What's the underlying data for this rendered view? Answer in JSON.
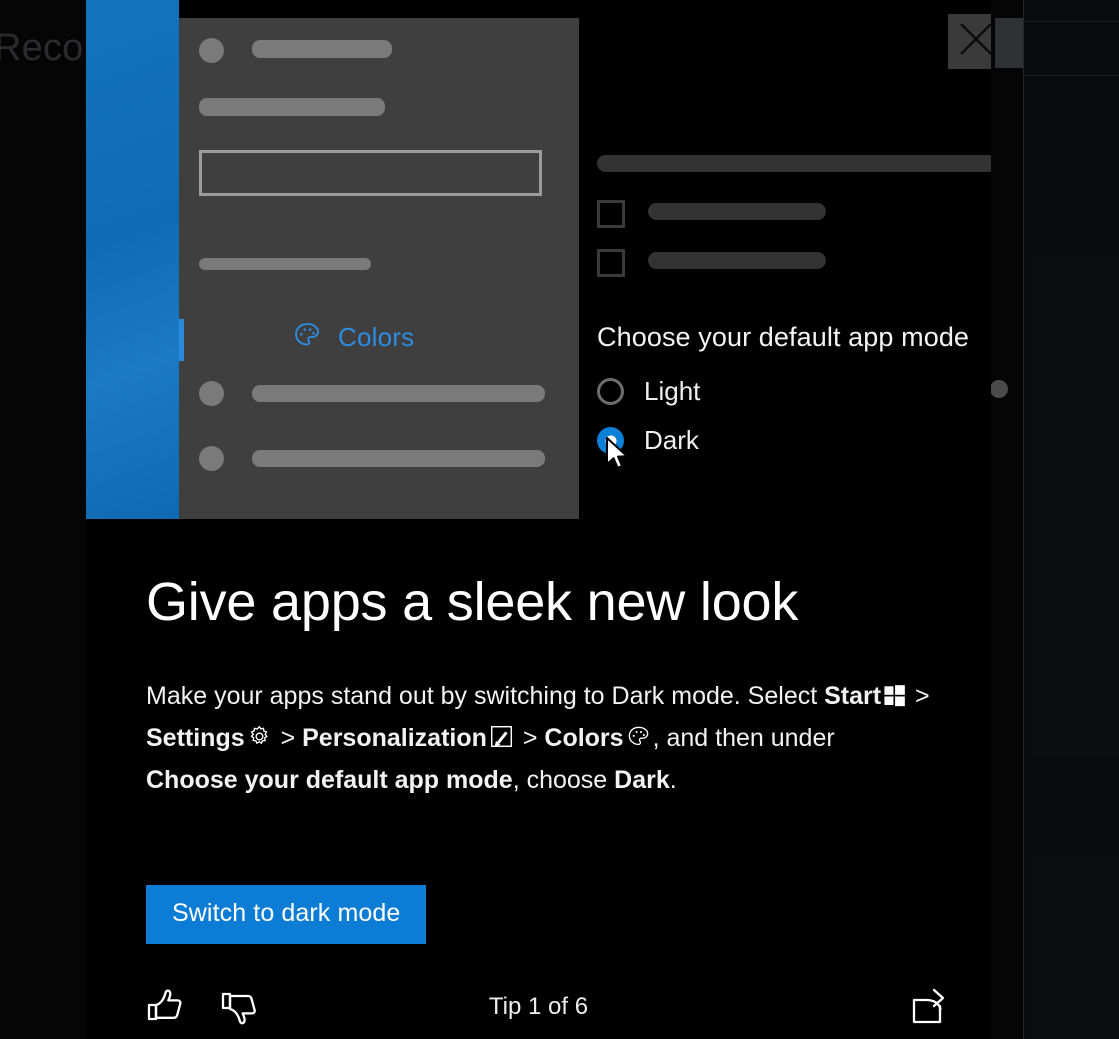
{
  "background": {
    "obscured_text": "Reco"
  },
  "dialog": {
    "close_label": "Close",
    "close_icon": "close-icon"
  },
  "illustration": {
    "settings_nav": {
      "selected_item": {
        "label": "Colors",
        "icon": "palette-icon",
        "accent_color": "#2a8ada",
        "text_color": "#2d8ce0"
      }
    },
    "settings_panel": {
      "section_heading": "Choose your default app mode",
      "options": [
        {
          "label": "Light",
          "selected": false
        },
        {
          "label": "Dark",
          "selected": true
        }
      ],
      "cursor_icon": "mouse-pointer-icon"
    },
    "colors": {
      "accent_blue": "#0f6cb4",
      "sidebar_gray": "#3f3f3f",
      "panel_black": "#000000"
    }
  },
  "tip": {
    "heading": "Give apps a sleek new look",
    "body": {
      "part1": "Make your apps stand out by switching to Dark mode. Select ",
      "start": "Start",
      "start_icon": "windows-logo-icon",
      "sep1": " > ",
      "settings": "Settings",
      "settings_icon": "gear-icon",
      "sep2": " > ",
      "personalization": "Personalization",
      "personalization_icon": "personalization-brush-icon",
      "sep3": " > ",
      "colors": "Colors",
      "colors_icon": "palette-icon",
      "part2": ", and then under ",
      "app_mode": "Choose your default app mode",
      "part3": ", choose ",
      "dark": "Dark",
      "part4": "."
    },
    "cta_label": "Switch to dark mode",
    "cta_color": "#0c7cd5"
  },
  "footer": {
    "like_icon": "thumbs-up-icon",
    "like_label": "Like this tip",
    "dislike_icon": "thumbs-down-icon",
    "dislike_label": "Dislike this tip",
    "counter": "Tip 1 of 6",
    "share_icon": "share-icon",
    "share_label": "Share this tip"
  }
}
